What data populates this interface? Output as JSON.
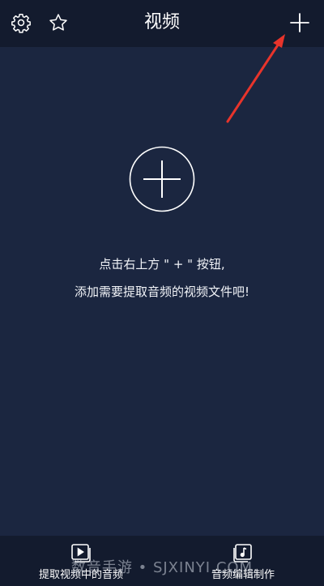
{
  "header": {
    "title": "视频",
    "settings_icon": "gear-icon",
    "favorites_icon": "star-icon",
    "add_icon": "plus-icon"
  },
  "main": {
    "add_button_icon": "plus-circle-icon",
    "hint_line1": "点击右上方 \" + \" 按钮,",
    "hint_line2": "添加需要提取音频的视频文件吧!"
  },
  "bottom_nav": {
    "tabs": [
      {
        "label": "提取视频中的音频",
        "icon": "video-play-icon"
      },
      {
        "label": "音频编辑制作",
        "icon": "music-note-icon"
      }
    ]
  },
  "watermark": "数音手游 • SJXINYI.COM",
  "colors": {
    "background": "#1b2640",
    "bar_background": "#131b2e",
    "annotation_arrow": "#e8342b"
  }
}
